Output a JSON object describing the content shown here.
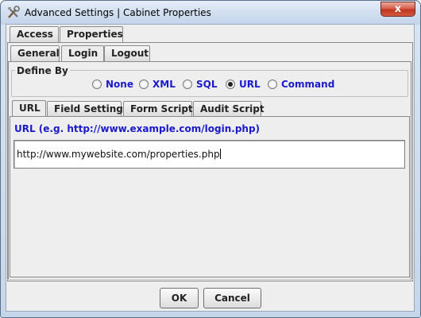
{
  "window": {
    "title": "Advanced Settings | Cabinet Properties",
    "close_glyph": "x"
  },
  "top_tabs": [
    {
      "label": "Access",
      "active": false
    },
    {
      "label": "Properties",
      "active": true
    }
  ],
  "sub_tabs": [
    {
      "label": "General",
      "active": false
    },
    {
      "label": "Login",
      "active": true
    },
    {
      "label": "Logout",
      "active": false
    }
  ],
  "define_by": {
    "title": "Define By",
    "options": [
      {
        "label": "None",
        "checked": false
      },
      {
        "label": "XML",
        "checked": false
      },
      {
        "label": "SQL",
        "checked": false
      },
      {
        "label": "URL",
        "checked": true
      },
      {
        "label": "Command",
        "checked": false
      }
    ]
  },
  "inner_tabs": [
    {
      "label": "URL",
      "active": true
    },
    {
      "label": "Field Settings",
      "active": false
    },
    {
      "label": "Form Script",
      "active": false
    },
    {
      "label": "Audit Script",
      "active": false
    }
  ],
  "url_section": {
    "label": "URL (e.g. http://www.example.com/login.php)",
    "value": "http://www.mywebsite.com/properties.php"
  },
  "buttons": {
    "ok": "OK",
    "cancel": "Cancel"
  },
  "colors": {
    "link_label": "#1a1acc",
    "close_button": "#c2351f",
    "title_bar": "#d3e0f0"
  }
}
